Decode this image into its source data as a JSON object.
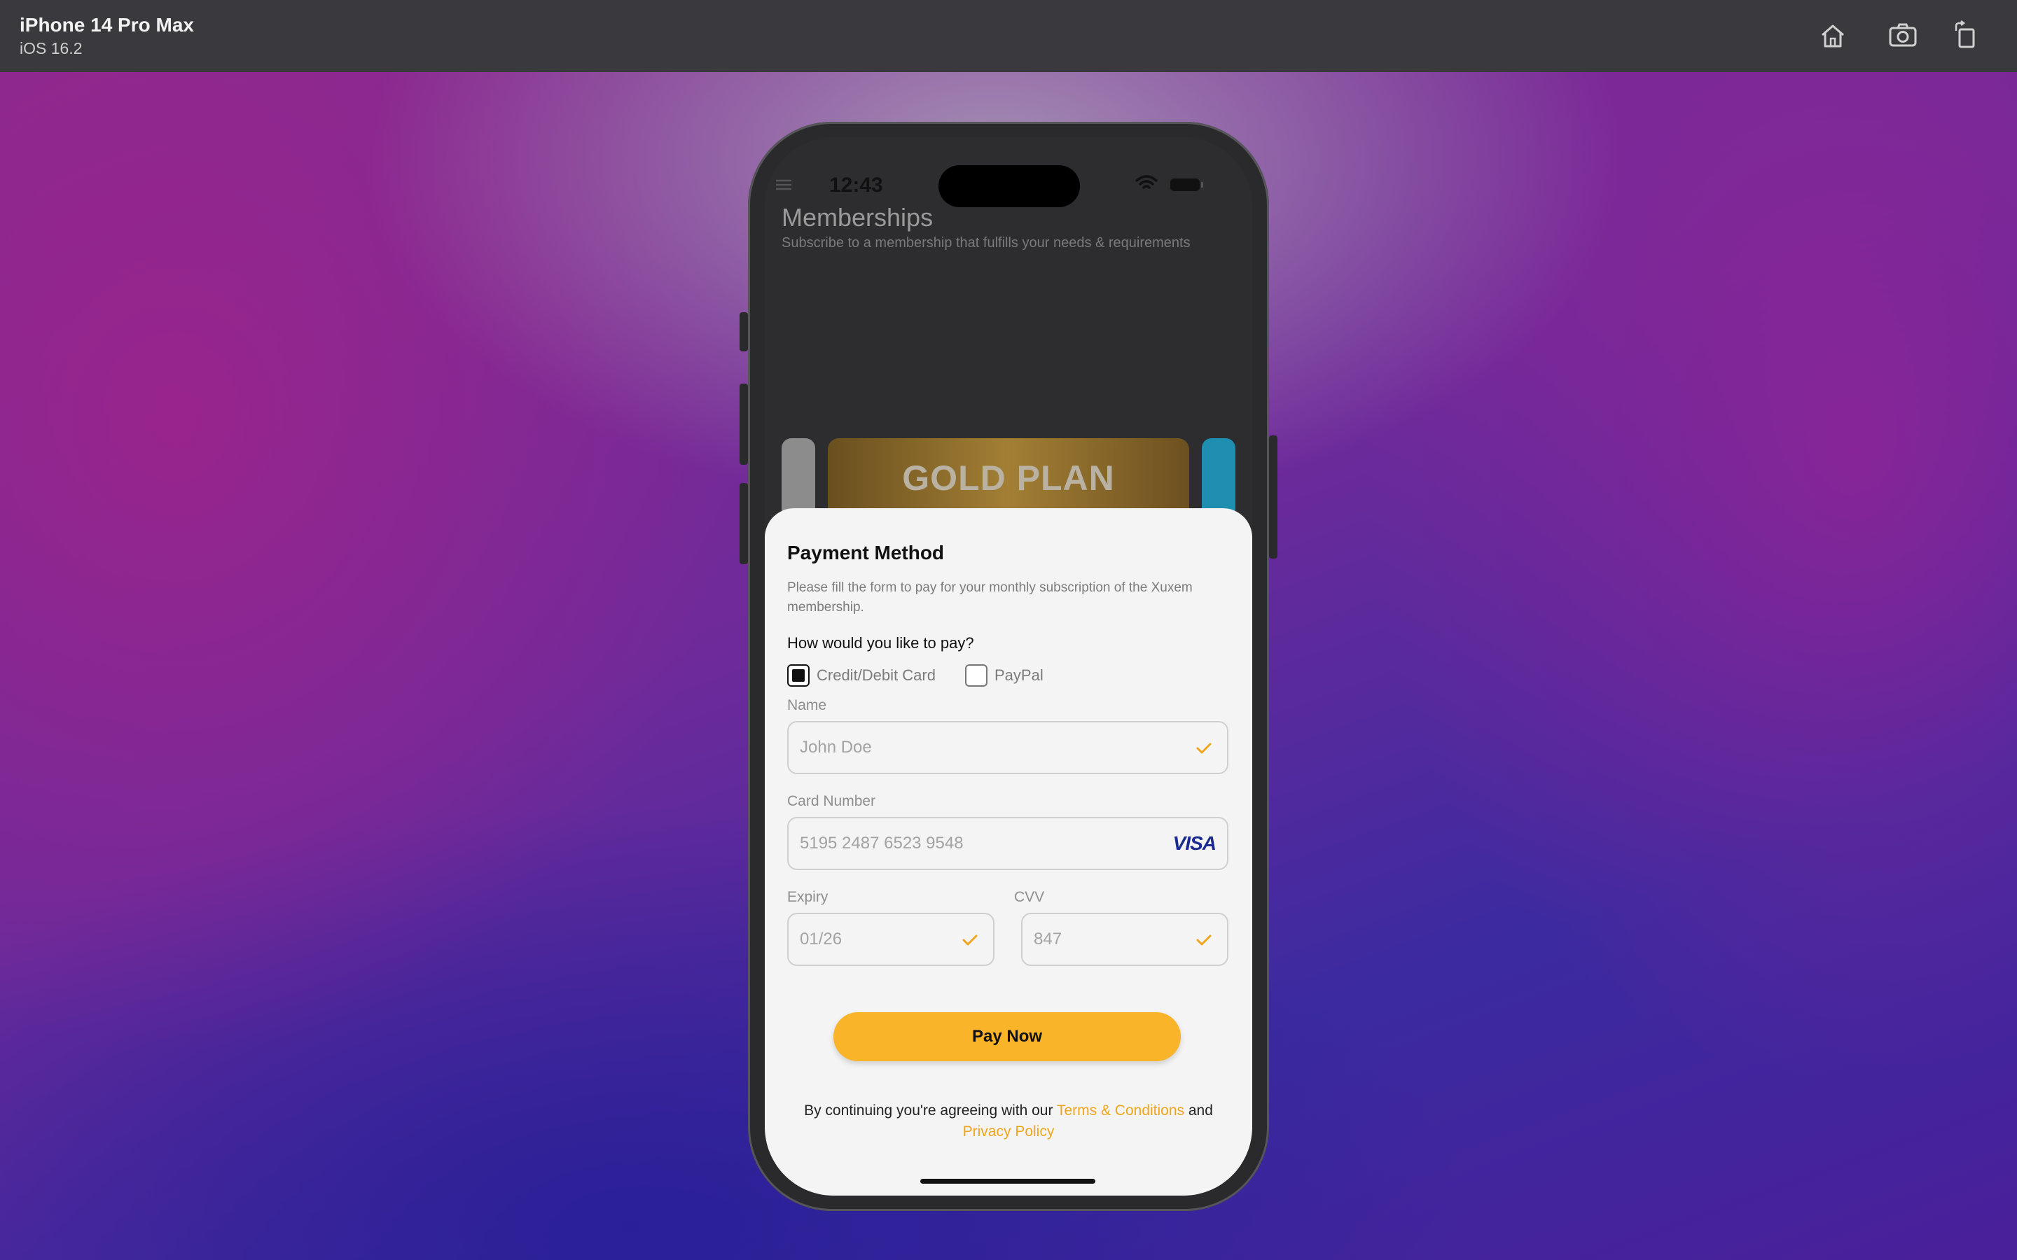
{
  "window": {
    "device_name": "iPhone 14 Pro Max",
    "os_version": "iOS 16.2"
  },
  "toolbar": {
    "home_icon": "home-icon",
    "screenshot_icon": "camera-icon",
    "rotate_icon": "rotate-icon"
  },
  "status_bar": {
    "time": "12:43"
  },
  "memberships": {
    "title": "Memberships",
    "subtitle": "Subscribe to a membership that fulfills your needs & requirements",
    "featured_plan": "GOLD PLAN"
  },
  "payment": {
    "title": "Payment Method",
    "description": "Please fill the form to pay for your monthly subscription of the Xuxem membership.",
    "question": "How would you like to pay?",
    "options": [
      {
        "label": "Credit/Debit Card",
        "checked": true
      },
      {
        "label": "PayPal",
        "checked": false
      }
    ],
    "name_label": "Name",
    "name_value": "John Doe",
    "card_label": "Card Number",
    "card_value": "5195 2487 6523 9548",
    "card_brand": "VISA",
    "expiry_label": "Expiry",
    "expiry_value": "01/26",
    "cvv_label": "CVV",
    "cvv_value": "847",
    "pay_button": "Pay Now",
    "terms_prefix": "By continuing you're agreeing with our ",
    "terms_link": "Terms & Conditions",
    "terms_and": " and",
    "privacy_link": "Privacy Policy"
  },
  "colors": {
    "accent": "#f9b429",
    "link": "#f0a51e",
    "visa_blue": "#1a2a8f"
  }
}
